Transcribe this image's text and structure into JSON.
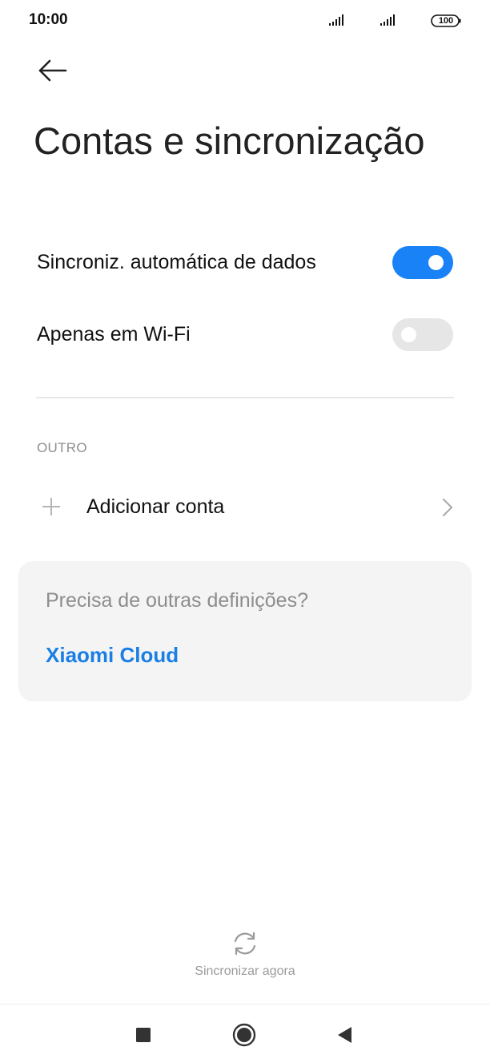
{
  "status_bar": {
    "time": "10:00",
    "battery": "100",
    "icons": [
      "signal-icon",
      "signal-icon",
      "battery-icon"
    ]
  },
  "header": {
    "back_icon": "arrow-left-icon",
    "title": "Contas e sincronização"
  },
  "settings": [
    {
      "label": "Sincroniz. automática de dados",
      "enabled": true
    },
    {
      "label": "Apenas em Wi-Fi",
      "enabled": false
    }
  ],
  "section": {
    "header": "OUTRO",
    "add_account": {
      "label": "Adicionar conta",
      "icon": "plus-icon",
      "trailing_icon": "chevron-right-icon"
    }
  },
  "card": {
    "question": "Precisa de outras definições?",
    "link": "Xiaomi Cloud"
  },
  "sync": {
    "icon": "sync-icon",
    "label": "Sincronizar agora"
  },
  "nav_bar": {
    "buttons": [
      "recents-icon",
      "home-icon",
      "back-triangle-icon"
    ]
  },
  "colors": {
    "accent": "#1a82f7",
    "link": "#1a7fe5",
    "toggle_off": "#e6e6e6",
    "card_bg": "#f4f4f4"
  }
}
